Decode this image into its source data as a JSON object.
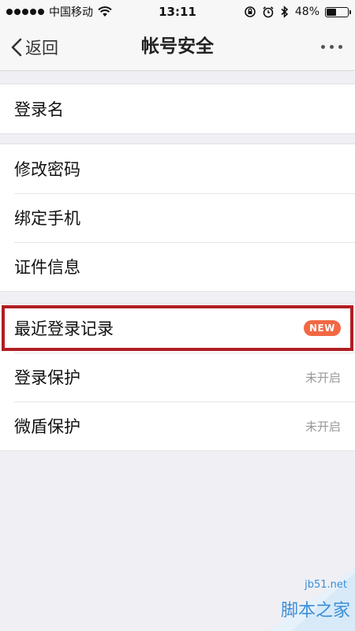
{
  "status_bar": {
    "carrier": "中国移动",
    "time": "13:11",
    "battery": "48%",
    "battery_level": 0.48
  },
  "nav": {
    "back_label": "返回",
    "title": "帐号安全"
  },
  "groups": [
    {
      "items": [
        {
          "label": "登录名"
        }
      ]
    },
    {
      "items": [
        {
          "label": "修改密码"
        },
        {
          "label": "绑定手机"
        },
        {
          "label": "证件信息"
        }
      ]
    },
    {
      "items": [
        {
          "label": "最近登录记录",
          "badge": "NEW"
        },
        {
          "label": "登录保护",
          "value": "未开启"
        },
        {
          "label": "微盾保护",
          "value": "未开启"
        }
      ]
    }
  ],
  "watermark": {
    "site": "jb51.net",
    "name": "脚本之家"
  },
  "colors": {
    "badge": "#f26843",
    "highlight": "#b01e23",
    "watermark": "#3a8fd9"
  }
}
